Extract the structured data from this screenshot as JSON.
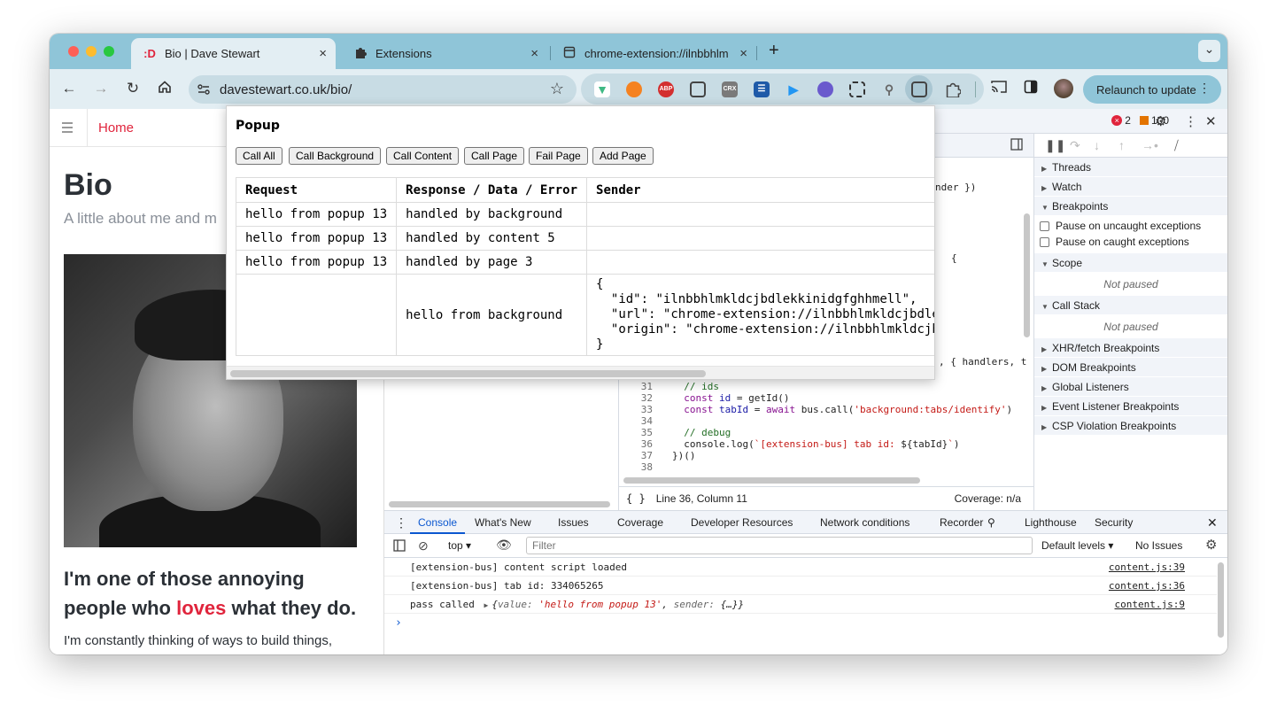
{
  "browser": {
    "tabs": [
      {
        "favicon": ":D",
        "title": "Bio | Dave Stewart",
        "close": "×"
      },
      {
        "favicon": "puzzle-icon",
        "title": "Extensions",
        "close": "×"
      },
      {
        "favicon": "page-icon",
        "title": "chrome-extension://ilnbbhlm",
        "close": "×"
      }
    ],
    "new_tab": "+",
    "tab_menu": "⌄",
    "url": "davestewart.co.uk/bio/",
    "relaunch_label": "Relaunch to update",
    "extensions": [
      {
        "icon": "vue-icon",
        "color": "#3fb984"
      },
      {
        "icon": "fox-icon",
        "color": "#f58220"
      },
      {
        "icon": "abp-icon",
        "label": "ABP",
        "color": "#d32f2f"
      },
      {
        "icon": "screenshot-icon",
        "color": "#555555"
      },
      {
        "icon": "crx-icon",
        "label": "CRX",
        "color": "#7a7a7a"
      },
      {
        "icon": "columns-icon",
        "color": "#1e5aa8"
      },
      {
        "icon": "play-icon",
        "color": "#2196f3"
      },
      {
        "icon": "cat-icon",
        "color": "#6a5acd"
      },
      {
        "icon": "scan-icon",
        "color": "#333333"
      },
      {
        "icon": "pin-icon",
        "color": "#666666"
      },
      {
        "icon": "extension-bus-icon",
        "color": "#444444"
      },
      {
        "icon": "puzzle-icon",
        "color": "#444444"
      }
    ]
  },
  "site": {
    "nav_home": "Home",
    "title": "Bio",
    "subtitle": "A little about me and m",
    "heading_pre": "I'm one of those annoying people who ",
    "heading_highlight": "loves",
    "heading_post": " what they do.",
    "paragraph": "I'm constantly thinking of ways to build things,"
  },
  "devtools": {
    "error_count": "2",
    "warning_count": "100",
    "code_fragments": {
      "frag1": "nder })",
      "frag2": "{",
      "frag3": ", { handlers, t"
    },
    "code_lines": [
      {
        "ln": "31",
        "parts": [
          {
            "t": "  ",
            "c": ""
          },
          {
            "t": "// ids",
            "c": "cmt"
          }
        ]
      },
      {
        "ln": "32",
        "parts": [
          {
            "t": "  ",
            "c": ""
          },
          {
            "t": "const",
            "c": "kw"
          },
          {
            "t": " ",
            "c": ""
          },
          {
            "t": "id",
            "c": "var"
          },
          {
            "t": " = getId()",
            "c": ""
          }
        ]
      },
      {
        "ln": "33",
        "parts": [
          {
            "t": "  ",
            "c": ""
          },
          {
            "t": "const",
            "c": "kw"
          },
          {
            "t": " ",
            "c": ""
          },
          {
            "t": "tabId",
            "c": "var"
          },
          {
            "t": " = ",
            "c": ""
          },
          {
            "t": "await",
            "c": "kw"
          },
          {
            "t": " bus.call(",
            "c": ""
          },
          {
            "t": "'background:tabs/identify'",
            "c": "str"
          },
          {
            "t": ")",
            "c": ""
          }
        ]
      },
      {
        "ln": "34",
        "parts": []
      },
      {
        "ln": "35",
        "parts": [
          {
            "t": "  ",
            "c": ""
          },
          {
            "t": "// debug",
            "c": "cmt"
          }
        ]
      },
      {
        "ln": "36",
        "parts": [
          {
            "t": "  console.log(",
            "c": ""
          },
          {
            "t": "`[extension-bus] tab id: ",
            "c": "str"
          },
          {
            "t": "${tabId}",
            "c": ""
          },
          {
            "t": "`",
            "c": "str"
          },
          {
            "t": ")",
            "c": ""
          }
        ]
      },
      {
        "ln": "37",
        "parts": [
          {
            "t": "})()",
            "c": ""
          }
        ]
      },
      {
        "ln": "38",
        "parts": []
      }
    ],
    "status_position": "Line 36, Column 11",
    "status_coverage": "Coverage: n/a",
    "debugger": {
      "sections_top": [
        "Threads",
        "Watch"
      ],
      "breakpoints_label": "Breakpoints",
      "pause_uncaught": "Pause on uncaught exceptions",
      "pause_caught": "Pause on caught exceptions",
      "scope_label": "Scope",
      "not_paused": "Not paused",
      "callstack_label": "Call Stack",
      "sections_bottom": [
        "XHR/fetch Breakpoints",
        "DOM Breakpoints",
        "Global Listeners",
        "Event Listener Breakpoints",
        "CSP Violation Breakpoints"
      ]
    },
    "drawer_tabs": [
      "Console",
      "What's New",
      "Issues",
      "Coverage",
      "Developer Resources",
      "Network conditions",
      "Recorder",
      "Lighthouse",
      "Security"
    ],
    "console": {
      "context": "top",
      "filter_placeholder": "Filter",
      "levels": "Default levels",
      "issues": "No Issues",
      "messages": [
        {
          "text": "[extension-bus] content script loaded",
          "source": "content.js:39"
        },
        {
          "text": "[extension-bus] tab id: 334065265",
          "source": "content.js:36"
        }
      ],
      "obj_msg": {
        "prefix": "pass called",
        "value_key": "value:",
        "value_str": "'hello from popup 13'",
        "sender_key": "sender:",
        "sender_val": "{…}",
        "source": "content.js:9"
      },
      "prompt": "›"
    }
  },
  "popup": {
    "title": "Popup",
    "buttons": [
      "Call All",
      "Call Background",
      "Call Content",
      "Call Page",
      "Fail Page",
      "Add Page"
    ],
    "columns": [
      "Request",
      "Response / Data / Error",
      "Sender"
    ],
    "rows": [
      {
        "request": "hello from popup 13",
        "response": "handled by background",
        "sender": ""
      },
      {
        "request": "hello from popup 13",
        "response": "handled by content 5",
        "sender": ""
      },
      {
        "request": "hello from popup 13",
        "response": "handled by page 3",
        "sender": ""
      },
      {
        "request": "",
        "response": "hello from background",
        "sender": "{\n  \"id\": \"ilnbbhlmkldcjbdlekkinidgfghhmell\",\n  \"url\": \"chrome-extension://ilnbbhlmkldcjbdle\n  \"origin\": \"chrome-extension://ilnbbhlmkldcjb\n}"
      }
    ]
  }
}
